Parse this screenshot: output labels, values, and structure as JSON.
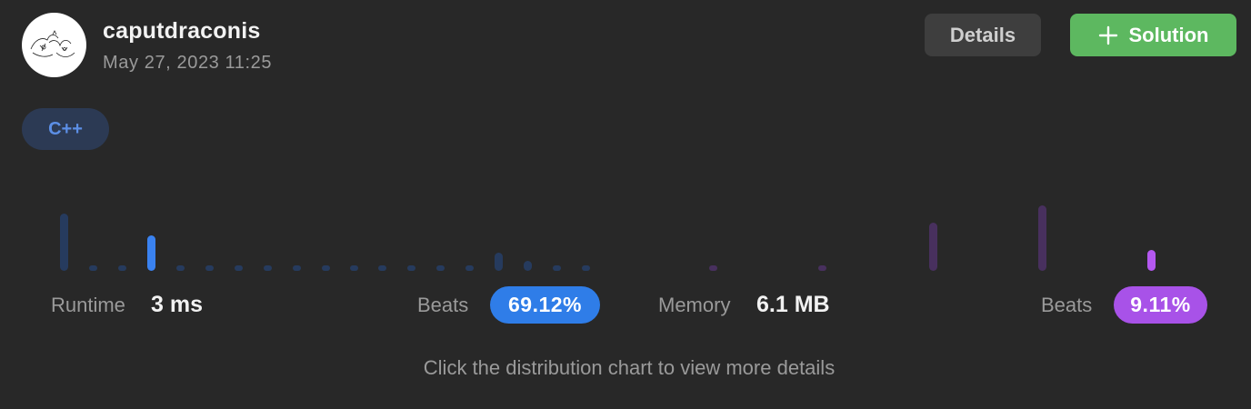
{
  "user": {
    "name": "caputdraconis",
    "timestamp": "May 27, 2023 11:25"
  },
  "actions": {
    "details_label": "Details",
    "solution_label": "Solution"
  },
  "language": "C++",
  "stats": {
    "runtime_label": "Runtime",
    "runtime_value": "3 ms",
    "runtime_beats_label": "Beats",
    "runtime_beats_value": "69.12%",
    "memory_label": "Memory",
    "memory_value": "6.1 MB",
    "memory_beats_label": "Beats",
    "memory_beats_value": "9.11%"
  },
  "hint": "Click the distribution chart to view more details",
  "colors": {
    "runtime_bar": "#263b5e",
    "runtime_bar_selected": "#3a82f0",
    "memory_bar": "#48305e",
    "memory_bar_selected": "#b458f0",
    "solution_button": "#5db860"
  },
  "chart_data": [
    {
      "type": "bar",
      "metric": "runtime",
      "values": [
        0.72,
        0.03,
        0.03,
        0.44,
        0.03,
        0.03,
        0.03,
        0.03,
        0.03,
        0.03,
        0.03,
        0.03,
        0.05,
        0.03,
        0.03,
        0.23,
        0.12,
        0.03,
        0.06
      ],
      "selected_index": 3
    },
    {
      "type": "bar",
      "metric": "memory",
      "values": [
        0.03,
        0.06,
        0.6,
        0.82,
        0.26
      ],
      "selected_index": 4
    }
  ]
}
